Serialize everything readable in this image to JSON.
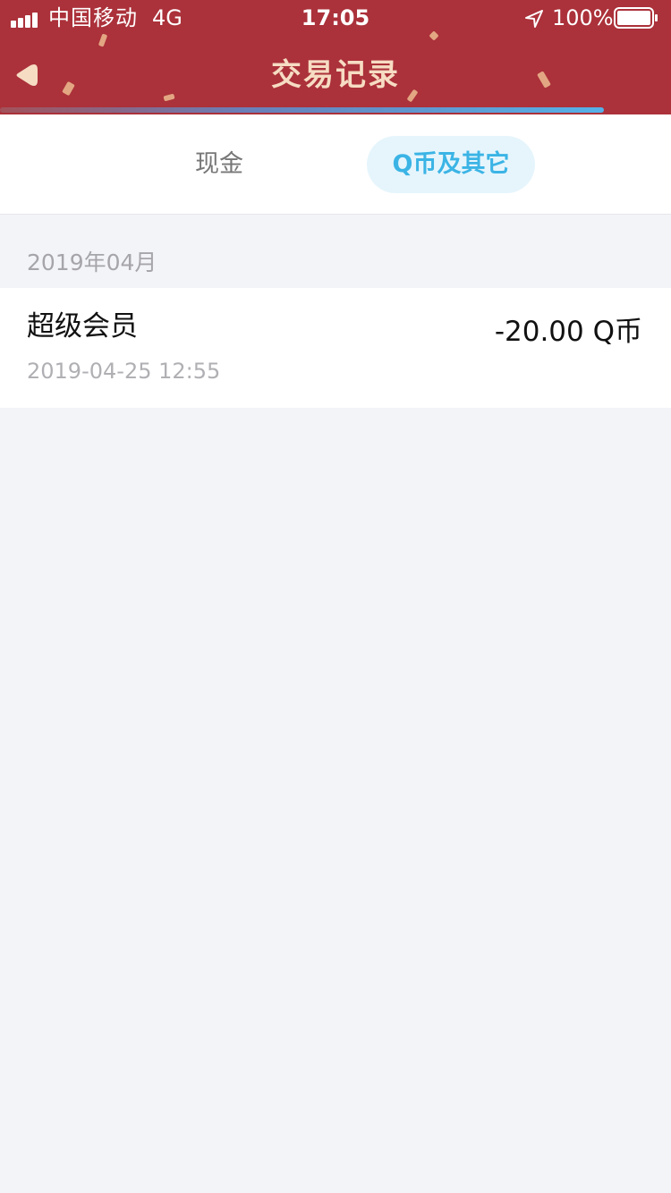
{
  "status_bar": {
    "carrier": "中国移动",
    "network": "4G",
    "time": "17:05",
    "battery": "100%",
    "icons": [
      "signal-icon",
      "location-arrow-icon",
      "battery-icon"
    ]
  },
  "navbar": {
    "title": "交易记录",
    "back_icon": "back-arrow-icon",
    "progress_fraction": 0.9
  },
  "tabs": [
    {
      "label": "现金",
      "selected": false
    },
    {
      "label": "Q币及其它",
      "selected": true
    }
  ],
  "records": {
    "month": "2019年04月",
    "items": [
      {
        "title": "超级会员",
        "time": "2019-04-25 12:55",
        "amount": "-20.00 Q币"
      }
    ]
  },
  "colors": {
    "header_bg": "#ab313a",
    "title_text": "#f6dcc3",
    "tab_active_bg": "#e6f5fc",
    "tab_active_text": "#3bb4e5",
    "page_bg": "#f3f4f8"
  }
}
